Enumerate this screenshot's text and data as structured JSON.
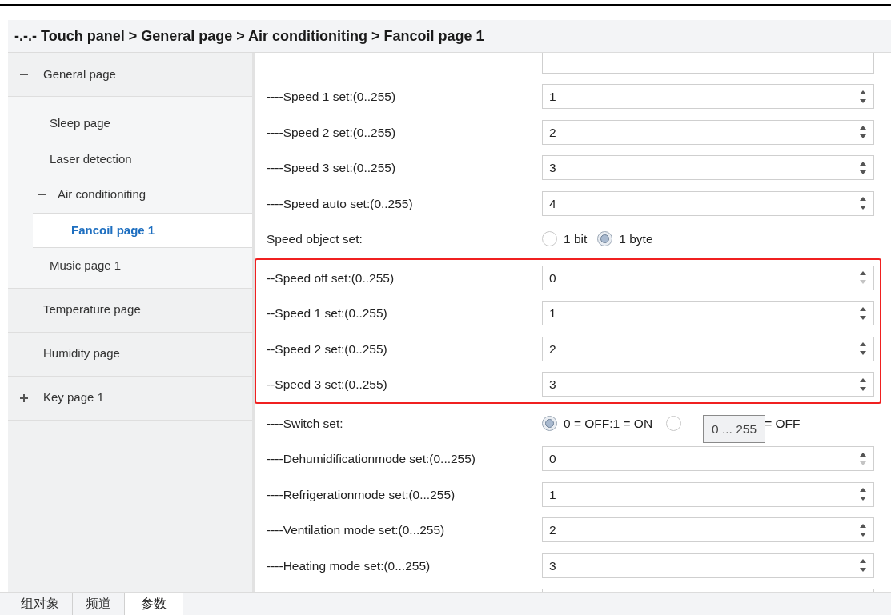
{
  "breadcrumb": "-.-.- Touch panel > General page > Air conditioniting > Fancoil page 1",
  "sidebar": {
    "items": [
      {
        "label": "General page",
        "expanded": true,
        "selected": false,
        "children": [
          {
            "label": "Sleep page",
            "selected": false
          },
          {
            "label": "Laser detection",
            "selected": false
          },
          {
            "label": "Air conditioniting",
            "expanded": true,
            "selected": false,
            "children": [
              {
                "label": "Fancoil page 1",
                "selected": true
              }
            ]
          },
          {
            "label": "Music page 1",
            "selected": false
          }
        ]
      },
      {
        "label": "Temperature page",
        "selected": false
      },
      {
        "label": "Humidity page",
        "selected": false
      },
      {
        "label": "Key page 1",
        "expanded": false,
        "selected": false
      }
    ]
  },
  "content": {
    "groups": [
      {
        "highlighted": false,
        "rows": [
          {
            "kind": "clipped"
          },
          {
            "kind": "number",
            "label": "----Speed 1 set:(0..255)",
            "value": "1",
            "down_disabled": false
          },
          {
            "kind": "number",
            "label": "----Speed 2 set:(0..255)",
            "value": "2",
            "down_disabled": false
          },
          {
            "kind": "number",
            "label": "----Speed 3 set:(0..255)",
            "value": "3",
            "down_disabled": false
          },
          {
            "kind": "number",
            "label": "----Speed auto set:(0..255)",
            "value": "4",
            "down_disabled": false
          },
          {
            "kind": "radio",
            "label": "Speed object set:",
            "options": [
              {
                "label": "1 bit",
                "selected": false
              },
              {
                "label": "1 byte",
                "selected": true
              }
            ]
          }
        ]
      },
      {
        "highlighted": true,
        "rows": [
          {
            "kind": "number",
            "label": "--Speed off set:(0..255)",
            "value": "0",
            "down_disabled": true
          },
          {
            "kind": "number",
            "label": "--Speed 1 set:(0..255)",
            "value": "1",
            "down_disabled": false
          },
          {
            "kind": "number",
            "label": "--Speed 2 set:(0..255)",
            "value": "2",
            "down_disabled": false
          },
          {
            "kind": "number",
            "label": "--Speed 3 set:(0..255)",
            "value": "3",
            "down_disabled": false
          }
        ]
      },
      {
        "highlighted": false,
        "rows": [
          {
            "kind": "radio",
            "label": "----Switch set:",
            "options": [
              {
                "label": "0 = OFF:1 = ON",
                "selected": true
              },
              {
                "label": "= OFF",
                "selected": false
              }
            ],
            "tooltip": "0 ... 255"
          },
          {
            "kind": "number",
            "label": "----Dehumidificationmode set:(0...255)",
            "value": "0",
            "down_disabled": true
          },
          {
            "kind": "number",
            "label": "----Refrigerationmode set:(0...255)",
            "value": "1",
            "down_disabled": false
          },
          {
            "kind": "number",
            "label": "----Ventilation mode set:(0...255)",
            "value": "2",
            "down_disabled": false
          },
          {
            "kind": "number",
            "label": "----Heating mode set:(0...255)",
            "value": "3",
            "down_disabled": false
          },
          {
            "kind": "clipped"
          }
        ]
      }
    ]
  },
  "bottom_tabs": [
    {
      "label": "组对象",
      "selected": false
    },
    {
      "label": "频道",
      "selected": false
    },
    {
      "label": "参数",
      "selected": true
    }
  ]
}
